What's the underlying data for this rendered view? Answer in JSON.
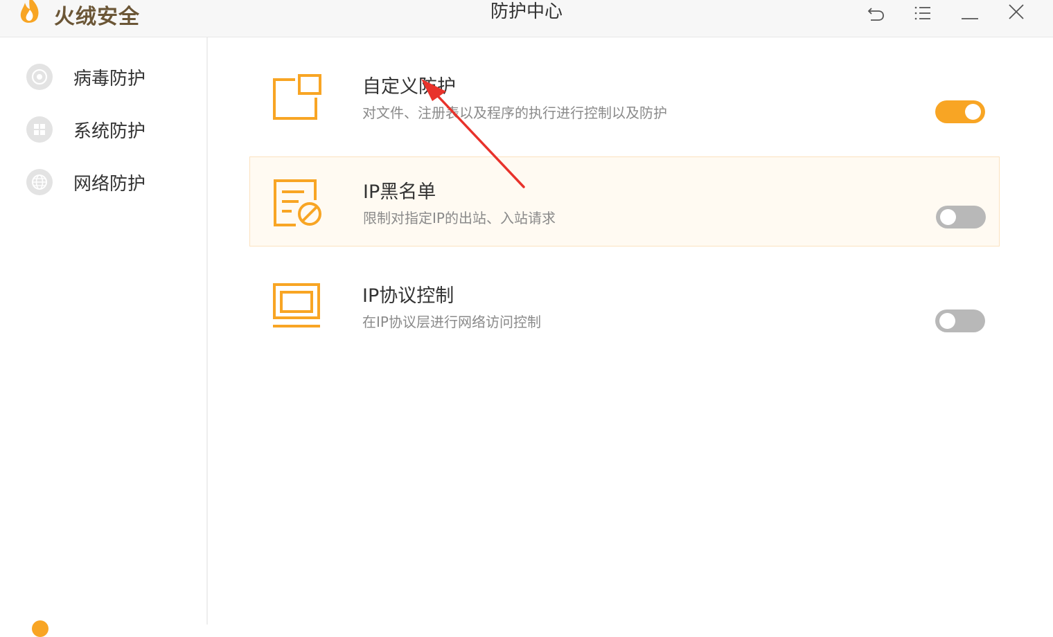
{
  "colors": {
    "accent": "#f8a524",
    "brand_text": "#6b5636",
    "toggle_off": "#b8b8b8",
    "annotation_arrow": "#e8322b"
  },
  "app": {
    "name": "火绒安全",
    "window_title": "防护中心"
  },
  "titlebar": {
    "buttons": [
      {
        "icon": "back-icon"
      },
      {
        "icon": "menu-icon"
      },
      {
        "icon": "minimize-icon"
      },
      {
        "icon": "close-icon"
      }
    ]
  },
  "sidebar": {
    "items": [
      {
        "label": "病毒防护",
        "icon": "virus-shield-icon"
      },
      {
        "label": "系统防护",
        "icon": "system-windows-icon"
      },
      {
        "label": "网络防护",
        "icon": "globe-icon"
      }
    ]
  },
  "protections": [
    {
      "title": "自定义防护",
      "desc": "对文件、注册表以及程序的执行进行控制以及防护",
      "enabled": true,
      "icon": "custom-protection-icon"
    },
    {
      "title": "IP黑名单",
      "desc": "限制对指定IP的出站、入站请求",
      "enabled": false,
      "icon": "ip-blacklist-icon",
      "highlighted": true
    },
    {
      "title": "IP协议控制",
      "desc": "在IP协议层进行网络访问控制",
      "enabled": false,
      "icon": "ip-protocol-icon"
    }
  ]
}
